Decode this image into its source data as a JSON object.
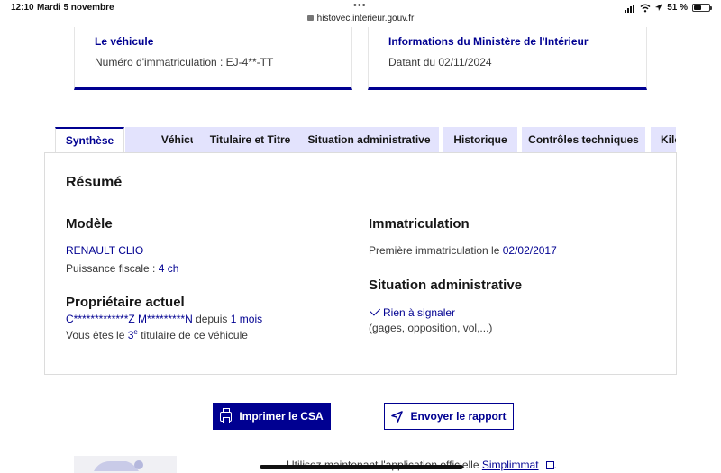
{
  "status_bar": {
    "time": "12:10",
    "date": "Mardi 5 novembre",
    "url": "histovec.interieur.gouv.fr",
    "battery": "51 %",
    "battery_level": 0.51
  },
  "cards": {
    "vehicle": {
      "title": "Le véhicule",
      "text": "Numéro d'immatriculation : EJ-4**-TT"
    },
    "ministry": {
      "title": "Informations du Ministère de l'Intérieur",
      "text": "Datant du 02/11/2024"
    }
  },
  "tabs": [
    {
      "label": "Synthèse",
      "active": true
    },
    {
      "label": "Véhicule"
    },
    {
      "label": "Titulaire et Titre"
    },
    {
      "label": "Situation administrative"
    },
    {
      "label": "Historique"
    },
    {
      "label": "Contrôles techniques"
    },
    {
      "label": "Kilo"
    }
  ],
  "summary": {
    "title": "Résumé",
    "model": {
      "heading": "Modèle",
      "name": "RENAULT CLIO",
      "power_label": "Puissance fiscale : ",
      "power_value": "4 ch"
    },
    "owner": {
      "heading": "Propriétaire actuel",
      "name": "C*************Z M*********N",
      "since_label": " depuis ",
      "since_value": "1 mois",
      "rank_prefix": "Vous êtes le ",
      "rank_value": "3",
      "rank_sup": "e",
      "rank_suffix": " titulaire de ce véhicule"
    },
    "registration": {
      "heading": "Immatriculation",
      "label": "Première immatriculation le ",
      "date": "02/02/2017"
    },
    "admin": {
      "heading": "Situation administrative",
      "status": "Rien à signaler",
      "details": "(gages, opposition, vol,...)"
    }
  },
  "buttons": {
    "print": "Imprimer le CSA",
    "send": "Envoyer le rapport"
  },
  "footer": {
    "text": "Utilisez maintenant l'application officielle ",
    "link": "Simplimmat",
    "end": "."
  },
  "colors": {
    "primary": "#000091",
    "tab_bg": "#e3e3fd"
  }
}
